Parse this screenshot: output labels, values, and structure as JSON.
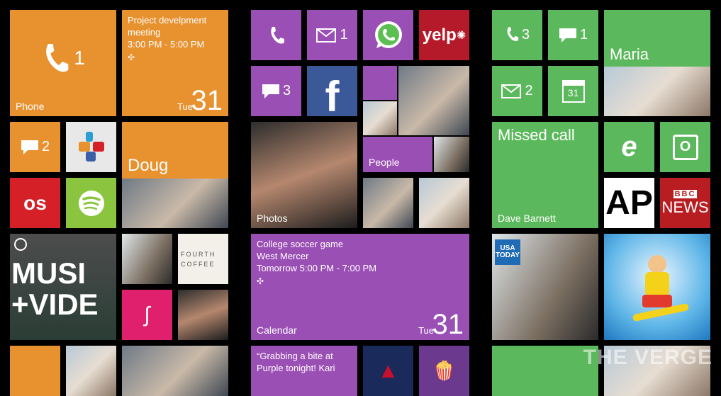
{
  "phone": {
    "label": "Phone",
    "count": "1"
  },
  "meeting": {
    "title": "Project develpment meeting",
    "time": "3:00 PM - 5:00 PM",
    "day": "Tue",
    "date": "31"
  },
  "messages_left": {
    "count": "2"
  },
  "doug": {
    "name": "Doug"
  },
  "music": {
    "text": "MUSI\n+VIDE"
  },
  "fourth_coffee": {
    "text": "FOURTH\nCOFFEE"
  },
  "purple_col": {
    "email_count": "1",
    "messages_count": "3",
    "yelp": "yelp",
    "photos_label": "Photos",
    "people_label": "People"
  },
  "calendar_big": {
    "line1": "College soccer game",
    "line2": "West Mercer",
    "line3": "Tomorrow 5:00 PM - 7:00 PM",
    "label": "Calendar",
    "day": "Tue",
    "date": "31"
  },
  "quote": {
    "text": "“Grabbing a bite at Purple tonight! Kari"
  },
  "green_col": {
    "voicemail_count": "3",
    "messages_count": "1",
    "email_count": "2",
    "calendar_date": "31",
    "maria": "Maria",
    "missed_call": "Missed call",
    "dave": "Dave Barnett",
    "ap": "AP",
    "bbc1": "BBC",
    "bbc2": "NEWS",
    "usatoday": "USA TODAY"
  },
  "watermark": "THE VERGE"
}
